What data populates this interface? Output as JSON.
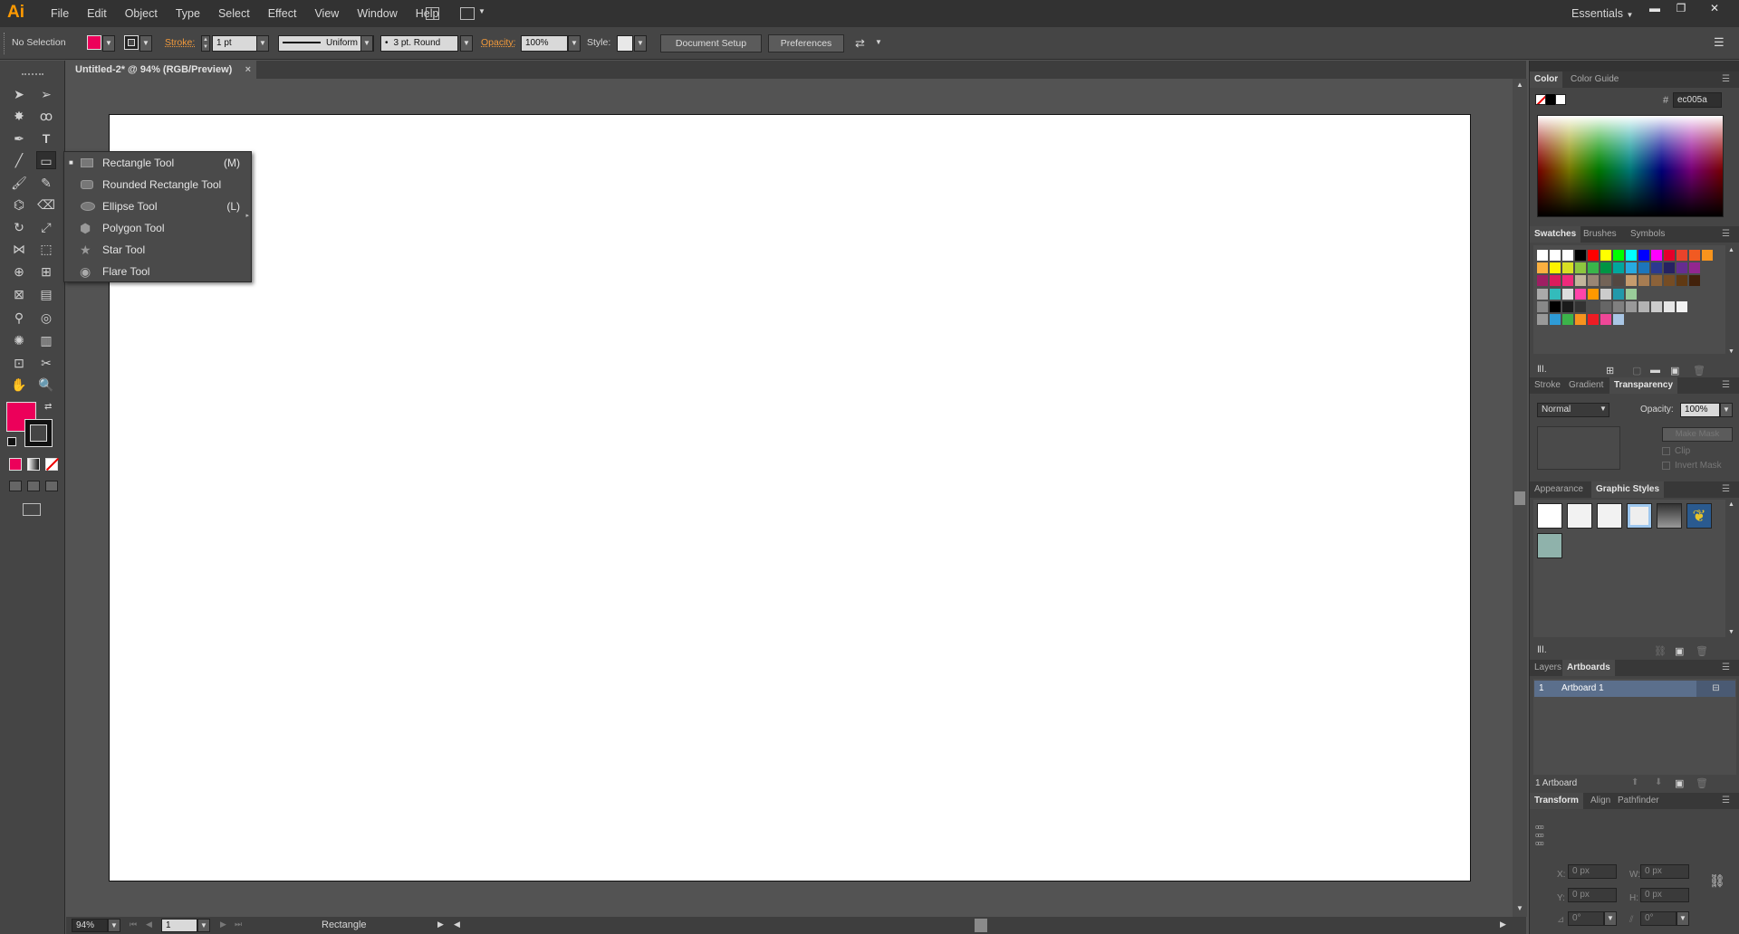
{
  "app": {
    "logo": "Ai",
    "workspace": "Essentials"
  },
  "menu": [
    "File",
    "Edit",
    "Object",
    "Type",
    "Select",
    "Effect",
    "View",
    "Window",
    "Help"
  ],
  "control": {
    "selection": "No Selection",
    "fill_color": "#ec005a",
    "stroke_label": "Stroke:",
    "stroke_weight": "1 pt",
    "profile": "Uniform",
    "brush": "3 pt. Round",
    "opacity_label": "Opacity:",
    "opacity": "100%",
    "style_label": "Style:",
    "document_setup": "Document Setup",
    "preferences": "Preferences"
  },
  "document": {
    "tab": "Untitled-2* @ 94% (RGB/Preview)",
    "close": "×"
  },
  "flyout": [
    {
      "name": "Rectangle Tool",
      "shortcut": "(M)",
      "icon": "rectangle-icon"
    },
    {
      "name": "Rounded Rectangle Tool",
      "shortcut": "",
      "icon": "rounded-rectangle-icon"
    },
    {
      "name": "Ellipse Tool",
      "shortcut": "(L)",
      "icon": "ellipse-icon"
    },
    {
      "name": "Polygon Tool",
      "shortcut": "",
      "icon": "polygon-icon"
    },
    {
      "name": "Star Tool",
      "shortcut": "",
      "icon": "star-icon"
    },
    {
      "name": "Flare Tool",
      "shortcut": "",
      "icon": "flare-icon"
    }
  ],
  "status": {
    "zoom": "94%",
    "artboard_num": "1",
    "tool": "Rectangle"
  },
  "panels": {
    "color": {
      "tabs": [
        "Color",
        "Color Guide"
      ],
      "hex_label": "#",
      "hex": "ec005a"
    },
    "swatches": {
      "tabs": [
        "Swatches",
        "Brushes",
        "Symbols"
      ]
    },
    "transparency": {
      "tabs": [
        "Stroke",
        "Gradient",
        "Transparency"
      ],
      "blend": "Normal",
      "opacity_label": "Opacity:",
      "opacity": "100%",
      "make_mask": "Make Mask",
      "clip": "Clip",
      "invert": "Invert Mask"
    },
    "styles": {
      "tabs": [
        "Appearance",
        "Graphic Styles"
      ]
    },
    "artboards": {
      "tabs": [
        "Layers",
        "Artboards"
      ],
      "rows": [
        {
          "num": "1",
          "name": "Artboard 1"
        }
      ],
      "count": "1 Artboard"
    },
    "transform": {
      "tabs": [
        "Transform",
        "Align",
        "Pathfinder"
      ],
      "x_label": "X:",
      "x": "0 px",
      "y_label": "Y:",
      "y": "0 px",
      "w_label": "W:",
      "w": "0 px",
      "h_label": "H:",
      "h": "0 px",
      "angle": "0°",
      "shear": "0°"
    }
  }
}
